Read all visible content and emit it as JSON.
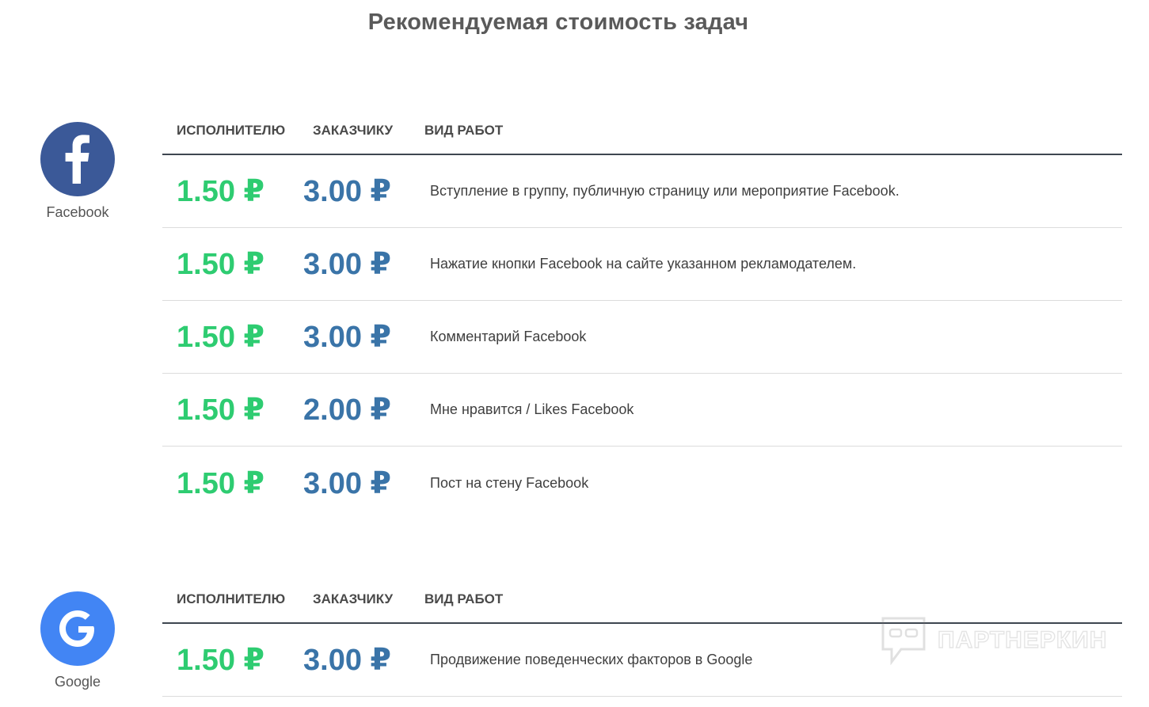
{
  "title": "Рекомендуемая стоимость задач",
  "columns": {
    "performer": "ИСПОЛНИТЕЛЮ",
    "customer": "ЗАКАЗЧИКУ",
    "work_type": "ВИД РАБОТ"
  },
  "sections": [
    {
      "brand": "Facebook",
      "icon": "facebook-icon",
      "color": "#3b5998",
      "rows": [
        {
          "performer": "1.50 ₽",
          "customer": "3.00 ₽",
          "work": "Вступление в группу, публичную страницу или мероприятие Facebook."
        },
        {
          "performer": "1.50 ₽",
          "customer": "3.00 ₽",
          "work": "Нажатие кнопки Facebook на сайте указанном рекламодателем."
        },
        {
          "performer": "1.50 ₽",
          "customer": "3.00 ₽",
          "work": "Комментарий Facebook"
        },
        {
          "performer": "1.50 ₽",
          "customer": "2.00 ₽",
          "work": "Мне нравится / Likes Facebook"
        },
        {
          "performer": "1.50 ₽",
          "customer": "3.00 ₽",
          "work": "Пост на стену Facebook"
        }
      ]
    },
    {
      "brand": "Google",
      "icon": "google-icon",
      "color": "#4285f4",
      "rows": [
        {
          "performer": "1.50 ₽",
          "customer": "3.00 ₽",
          "work": "Продвижение поведенческих факторов в Google"
        }
      ]
    }
  ],
  "watermark": "ПАРТНЕРКИН",
  "colors": {
    "performer_price": "#2ecc71",
    "customer_price": "#3a74a8"
  }
}
